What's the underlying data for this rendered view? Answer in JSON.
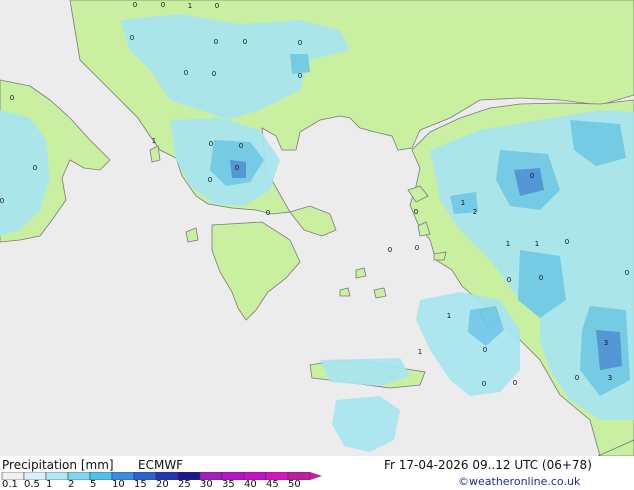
{
  "footer": {
    "product_label": "Precipitation [mm]",
    "model": "ECMWF",
    "valid_time": "Fr 17-04-2026 09..12 UTC (06+78)",
    "credit": "©weatheronline.co.uk"
  },
  "legend": {
    "ticks": [
      "0.1",
      "0.5",
      "1",
      "2",
      "5",
      "10",
      "15",
      "20",
      "25",
      "30",
      "35",
      "40",
      "45",
      "50"
    ],
    "colors": [
      "#f0f0f0",
      "#d8f2f8",
      "#b0e8f5",
      "#7fd8ef",
      "#4ec3ea",
      "#3b8de0",
      "#2f63d0",
      "#2438b5",
      "#1a1a90",
      "#a020c0",
      "#b814c8",
      "#c810c8",
      "#d816c0",
      "#c020a0"
    ]
  },
  "colors": {
    "sea": "#ececec",
    "land": "#c8f0a0",
    "precip_light": "#a8e6f0",
    "precip_moderate": "#6fc7ea",
    "precip_heavy": "#4a90d9",
    "coast": "#7a7a7a"
  },
  "map": {
    "amount_labels": [
      "0",
      "0",
      "1",
      "0",
      "0",
      "0",
      "0",
      "0",
      "0",
      "0",
      "0",
      "1",
      "0",
      "0",
      "0",
      "0",
      "0",
      "0",
      "0",
      "0",
      "0",
      "1",
      "2",
      "0",
      "1",
      "1",
      "0",
      "0",
      "3",
      "3",
      "0",
      "0",
      "0",
      "0",
      "0",
      "1",
      "1",
      "0",
      "0",
      "0"
    ]
  }
}
